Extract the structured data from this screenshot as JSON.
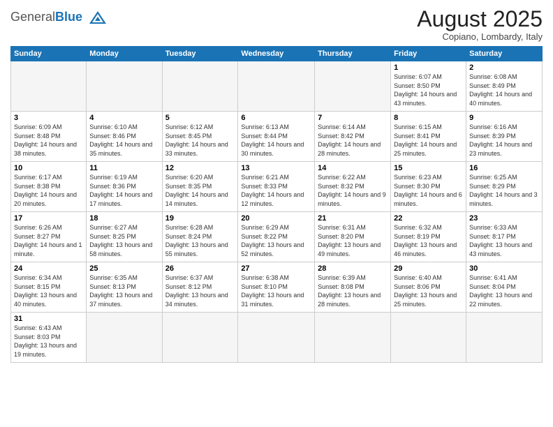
{
  "header": {
    "logo_general": "General",
    "logo_blue": "Blue",
    "month_title": "August 2025",
    "subtitle": "Copiano, Lombardy, Italy"
  },
  "days_of_week": [
    "Sunday",
    "Monday",
    "Tuesday",
    "Wednesday",
    "Thursday",
    "Friday",
    "Saturday"
  ],
  "weeks": [
    [
      {
        "day": "",
        "info": ""
      },
      {
        "day": "",
        "info": ""
      },
      {
        "day": "",
        "info": ""
      },
      {
        "day": "",
        "info": ""
      },
      {
        "day": "",
        "info": ""
      },
      {
        "day": "1",
        "info": "Sunrise: 6:07 AM\nSunset: 8:50 PM\nDaylight: 14 hours and 43 minutes."
      },
      {
        "day": "2",
        "info": "Sunrise: 6:08 AM\nSunset: 8:49 PM\nDaylight: 14 hours and 40 minutes."
      }
    ],
    [
      {
        "day": "3",
        "info": "Sunrise: 6:09 AM\nSunset: 8:48 PM\nDaylight: 14 hours and 38 minutes."
      },
      {
        "day": "4",
        "info": "Sunrise: 6:10 AM\nSunset: 8:46 PM\nDaylight: 14 hours and 35 minutes."
      },
      {
        "day": "5",
        "info": "Sunrise: 6:12 AM\nSunset: 8:45 PM\nDaylight: 14 hours and 33 minutes."
      },
      {
        "day": "6",
        "info": "Sunrise: 6:13 AM\nSunset: 8:44 PM\nDaylight: 14 hours and 30 minutes."
      },
      {
        "day": "7",
        "info": "Sunrise: 6:14 AM\nSunset: 8:42 PM\nDaylight: 14 hours and 28 minutes."
      },
      {
        "day": "8",
        "info": "Sunrise: 6:15 AM\nSunset: 8:41 PM\nDaylight: 14 hours and 25 minutes."
      },
      {
        "day": "9",
        "info": "Sunrise: 6:16 AM\nSunset: 8:39 PM\nDaylight: 14 hours and 23 minutes."
      }
    ],
    [
      {
        "day": "10",
        "info": "Sunrise: 6:17 AM\nSunset: 8:38 PM\nDaylight: 14 hours and 20 minutes."
      },
      {
        "day": "11",
        "info": "Sunrise: 6:19 AM\nSunset: 8:36 PM\nDaylight: 14 hours and 17 minutes."
      },
      {
        "day": "12",
        "info": "Sunrise: 6:20 AM\nSunset: 8:35 PM\nDaylight: 14 hours and 14 minutes."
      },
      {
        "day": "13",
        "info": "Sunrise: 6:21 AM\nSunset: 8:33 PM\nDaylight: 14 hours and 12 minutes."
      },
      {
        "day": "14",
        "info": "Sunrise: 6:22 AM\nSunset: 8:32 PM\nDaylight: 14 hours and 9 minutes."
      },
      {
        "day": "15",
        "info": "Sunrise: 6:23 AM\nSunset: 8:30 PM\nDaylight: 14 hours and 6 minutes."
      },
      {
        "day": "16",
        "info": "Sunrise: 6:25 AM\nSunset: 8:29 PM\nDaylight: 14 hours and 3 minutes."
      }
    ],
    [
      {
        "day": "17",
        "info": "Sunrise: 6:26 AM\nSunset: 8:27 PM\nDaylight: 14 hours and 1 minute."
      },
      {
        "day": "18",
        "info": "Sunrise: 6:27 AM\nSunset: 8:25 PM\nDaylight: 13 hours and 58 minutes."
      },
      {
        "day": "19",
        "info": "Sunrise: 6:28 AM\nSunset: 8:24 PM\nDaylight: 13 hours and 55 minutes."
      },
      {
        "day": "20",
        "info": "Sunrise: 6:29 AM\nSunset: 8:22 PM\nDaylight: 13 hours and 52 minutes."
      },
      {
        "day": "21",
        "info": "Sunrise: 6:31 AM\nSunset: 8:20 PM\nDaylight: 13 hours and 49 minutes."
      },
      {
        "day": "22",
        "info": "Sunrise: 6:32 AM\nSunset: 8:19 PM\nDaylight: 13 hours and 46 minutes."
      },
      {
        "day": "23",
        "info": "Sunrise: 6:33 AM\nSunset: 8:17 PM\nDaylight: 13 hours and 43 minutes."
      }
    ],
    [
      {
        "day": "24",
        "info": "Sunrise: 6:34 AM\nSunset: 8:15 PM\nDaylight: 13 hours and 40 minutes."
      },
      {
        "day": "25",
        "info": "Sunrise: 6:35 AM\nSunset: 8:13 PM\nDaylight: 13 hours and 37 minutes."
      },
      {
        "day": "26",
        "info": "Sunrise: 6:37 AM\nSunset: 8:12 PM\nDaylight: 13 hours and 34 minutes."
      },
      {
        "day": "27",
        "info": "Sunrise: 6:38 AM\nSunset: 8:10 PM\nDaylight: 13 hours and 31 minutes."
      },
      {
        "day": "28",
        "info": "Sunrise: 6:39 AM\nSunset: 8:08 PM\nDaylight: 13 hours and 28 minutes."
      },
      {
        "day": "29",
        "info": "Sunrise: 6:40 AM\nSunset: 8:06 PM\nDaylight: 13 hours and 25 minutes."
      },
      {
        "day": "30",
        "info": "Sunrise: 6:41 AM\nSunset: 8:04 PM\nDaylight: 13 hours and 22 minutes."
      }
    ],
    [
      {
        "day": "31",
        "info": "Sunrise: 6:43 AM\nSunset: 8:03 PM\nDaylight: 13 hours and 19 minutes."
      },
      {
        "day": "",
        "info": ""
      },
      {
        "day": "",
        "info": ""
      },
      {
        "day": "",
        "info": ""
      },
      {
        "day": "",
        "info": ""
      },
      {
        "day": "",
        "info": ""
      },
      {
        "day": "",
        "info": ""
      }
    ]
  ]
}
